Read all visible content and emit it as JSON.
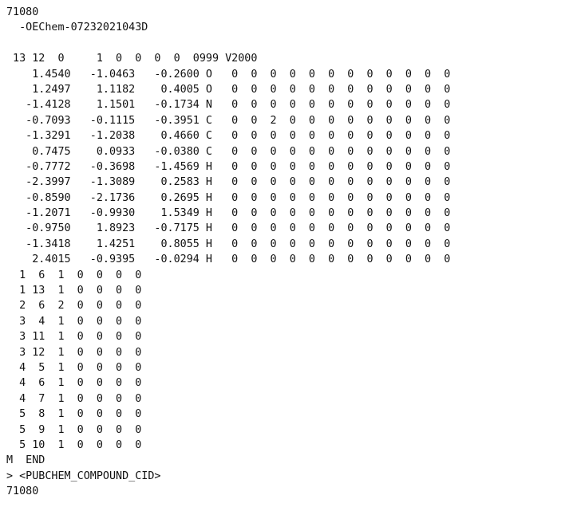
{
  "document": {
    "header_lines": [
      "71080",
      "  -OEChem-07232021043D",
      "",
      " 13 12  0     1  0  0  0  0  0999 V2000"
    ],
    "atom_lines": [
      "    1.4540   -1.0463   -0.2600 O   0  0  0  0  0  0  0  0  0  0  0  0",
      "    1.2497    1.1182    0.4005 O   0  0  0  0  0  0  0  0  0  0  0  0",
      "   -1.4128    1.1501   -0.1734 N   0  0  0  0  0  0  0  0  0  0  0  0",
      "   -0.7093   -0.1115   -0.3951 C   0  0  2  0  0  0  0  0  0  0  0  0",
      "   -1.3291   -1.2038    0.4660 C   0  0  0  0  0  0  0  0  0  0  0  0",
      "    0.7475    0.0933   -0.0380 C   0  0  0  0  0  0  0  0  0  0  0  0",
      "   -0.7772   -0.3698   -1.4569 H   0  0  0  0  0  0  0  0  0  0  0  0",
      "   -2.3997   -1.3089    0.2583 H   0  0  0  0  0  0  0  0  0  0  0  0",
      "   -0.8590   -2.1736    0.2695 H   0  0  0  0  0  0  0  0  0  0  0  0",
      "   -1.2071   -0.9930    1.5349 H   0  0  0  0  0  0  0  0  0  0  0  0",
      "   -0.9750    1.8923   -0.7175 H   0  0  0  0  0  0  0  0  0  0  0  0",
      "   -1.3418    1.4251    0.8055 H   0  0  0  0  0  0  0  0  0  0  0  0",
      "    2.4015   -0.9395   -0.0294 H   0  0  0  0  0  0  0  0  0  0  0  0"
    ],
    "bond_lines": [
      "  1  6  1  0  0  0  0",
      "  1 13  1  0  0  0  0",
      "  2  6  2  0  0  0  0",
      "  3  4  1  0  0  0  0",
      "  3 11  1  0  0  0  0",
      "  3 12  1  0  0  0  0",
      "  4  5  1  0  0  0  0",
      "  4  6  1  0  0  0  0",
      "  4  7  1  0  0  0  0",
      "  5  8  1  0  0  0  0",
      "  5  9  1  0  0  0  0",
      "  5 10  1  0  0  0  0"
    ],
    "footer_lines": [
      "M  END",
      "> <PUBCHEM_COMPOUND_CID>",
      "71080"
    ]
  }
}
